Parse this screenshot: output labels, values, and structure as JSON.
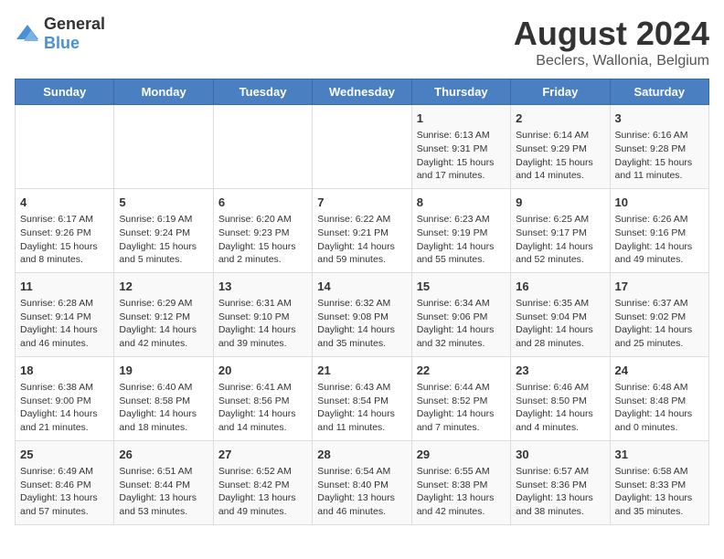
{
  "app": {
    "logo_general": "General",
    "logo_blue": "Blue"
  },
  "header": {
    "title": "August 2024",
    "subtitle": "Beclers, Wallonia, Belgium"
  },
  "calendar": {
    "days_of_week": [
      "Sunday",
      "Monday",
      "Tuesday",
      "Wednesday",
      "Thursday",
      "Friday",
      "Saturday"
    ],
    "weeks": [
      [
        {
          "day": "",
          "content": ""
        },
        {
          "day": "",
          "content": ""
        },
        {
          "day": "",
          "content": ""
        },
        {
          "day": "",
          "content": ""
        },
        {
          "day": "1",
          "content": "Sunrise: 6:13 AM\nSunset: 9:31 PM\nDaylight: 15 hours and 17 minutes."
        },
        {
          "day": "2",
          "content": "Sunrise: 6:14 AM\nSunset: 9:29 PM\nDaylight: 15 hours and 14 minutes."
        },
        {
          "day": "3",
          "content": "Sunrise: 6:16 AM\nSunset: 9:28 PM\nDaylight: 15 hours and 11 minutes."
        }
      ],
      [
        {
          "day": "4",
          "content": "Sunrise: 6:17 AM\nSunset: 9:26 PM\nDaylight: 15 hours and 8 minutes."
        },
        {
          "day": "5",
          "content": "Sunrise: 6:19 AM\nSunset: 9:24 PM\nDaylight: 15 hours and 5 minutes."
        },
        {
          "day": "6",
          "content": "Sunrise: 6:20 AM\nSunset: 9:23 PM\nDaylight: 15 hours and 2 minutes."
        },
        {
          "day": "7",
          "content": "Sunrise: 6:22 AM\nSunset: 9:21 PM\nDaylight: 14 hours and 59 minutes."
        },
        {
          "day": "8",
          "content": "Sunrise: 6:23 AM\nSunset: 9:19 PM\nDaylight: 14 hours and 55 minutes."
        },
        {
          "day": "9",
          "content": "Sunrise: 6:25 AM\nSunset: 9:17 PM\nDaylight: 14 hours and 52 minutes."
        },
        {
          "day": "10",
          "content": "Sunrise: 6:26 AM\nSunset: 9:16 PM\nDaylight: 14 hours and 49 minutes."
        }
      ],
      [
        {
          "day": "11",
          "content": "Sunrise: 6:28 AM\nSunset: 9:14 PM\nDaylight: 14 hours and 46 minutes."
        },
        {
          "day": "12",
          "content": "Sunrise: 6:29 AM\nSunset: 9:12 PM\nDaylight: 14 hours and 42 minutes."
        },
        {
          "day": "13",
          "content": "Sunrise: 6:31 AM\nSunset: 9:10 PM\nDaylight: 14 hours and 39 minutes."
        },
        {
          "day": "14",
          "content": "Sunrise: 6:32 AM\nSunset: 9:08 PM\nDaylight: 14 hours and 35 minutes."
        },
        {
          "day": "15",
          "content": "Sunrise: 6:34 AM\nSunset: 9:06 PM\nDaylight: 14 hours and 32 minutes."
        },
        {
          "day": "16",
          "content": "Sunrise: 6:35 AM\nSunset: 9:04 PM\nDaylight: 14 hours and 28 minutes."
        },
        {
          "day": "17",
          "content": "Sunrise: 6:37 AM\nSunset: 9:02 PM\nDaylight: 14 hours and 25 minutes."
        }
      ],
      [
        {
          "day": "18",
          "content": "Sunrise: 6:38 AM\nSunset: 9:00 PM\nDaylight: 14 hours and 21 minutes."
        },
        {
          "day": "19",
          "content": "Sunrise: 6:40 AM\nSunset: 8:58 PM\nDaylight: 14 hours and 18 minutes."
        },
        {
          "day": "20",
          "content": "Sunrise: 6:41 AM\nSunset: 8:56 PM\nDaylight: 14 hours and 14 minutes."
        },
        {
          "day": "21",
          "content": "Sunrise: 6:43 AM\nSunset: 8:54 PM\nDaylight: 14 hours and 11 minutes."
        },
        {
          "day": "22",
          "content": "Sunrise: 6:44 AM\nSunset: 8:52 PM\nDaylight: 14 hours and 7 minutes."
        },
        {
          "day": "23",
          "content": "Sunrise: 6:46 AM\nSunset: 8:50 PM\nDaylight: 14 hours and 4 minutes."
        },
        {
          "day": "24",
          "content": "Sunrise: 6:48 AM\nSunset: 8:48 PM\nDaylight: 14 hours and 0 minutes."
        }
      ],
      [
        {
          "day": "25",
          "content": "Sunrise: 6:49 AM\nSunset: 8:46 PM\nDaylight: 13 hours and 57 minutes."
        },
        {
          "day": "26",
          "content": "Sunrise: 6:51 AM\nSunset: 8:44 PM\nDaylight: 13 hours and 53 minutes."
        },
        {
          "day": "27",
          "content": "Sunrise: 6:52 AM\nSunset: 8:42 PM\nDaylight: 13 hours and 49 minutes."
        },
        {
          "day": "28",
          "content": "Sunrise: 6:54 AM\nSunset: 8:40 PM\nDaylight: 13 hours and 46 minutes."
        },
        {
          "day": "29",
          "content": "Sunrise: 6:55 AM\nSunset: 8:38 PM\nDaylight: 13 hours and 42 minutes."
        },
        {
          "day": "30",
          "content": "Sunrise: 6:57 AM\nSunset: 8:36 PM\nDaylight: 13 hours and 38 minutes."
        },
        {
          "day": "31",
          "content": "Sunrise: 6:58 AM\nSunset: 8:33 PM\nDaylight: 13 hours and 35 minutes."
        }
      ]
    ]
  }
}
